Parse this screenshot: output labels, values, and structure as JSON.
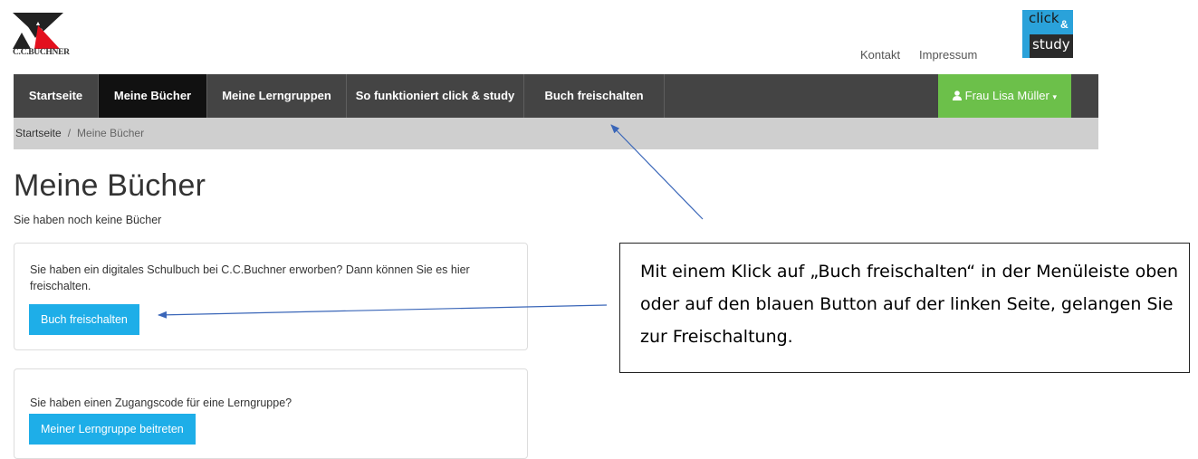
{
  "header": {
    "publisher_logo": {
      "text": "C.C.BUCHNER",
      "colors": {
        "red": "#e3101e",
        "dark": "#222222"
      }
    },
    "product_logo": {
      "click": "click",
      "amp": "&",
      "study": "study",
      "colors": {
        "blue": "#2aa2da",
        "dark": "#2b2b2b"
      }
    },
    "links": {
      "kontakt": "Kontakt",
      "impressum": "Impressum"
    }
  },
  "nav": {
    "items": [
      {
        "label": "Startseite"
      },
      {
        "label": "Meine Bücher",
        "active": true
      },
      {
        "label": "Meine Lerngruppen"
      },
      {
        "label": "So funktioniert click & study"
      },
      {
        "label": "Buch freischalten"
      }
    ],
    "user": {
      "icon": "user-icon",
      "label": "Frau Lisa Müller",
      "caret": "▾"
    },
    "colors": {
      "bar": "#444444",
      "active": "#111111",
      "user": "#6cc04a"
    }
  },
  "breadcrumb": {
    "home": "Startseite",
    "separator": "/",
    "current": "Meine Bücher"
  },
  "main": {
    "title": "Meine Bücher",
    "subtitle": "Sie haben noch keine Bücher",
    "panel_unlock": {
      "text": "Sie haben ein digitales Schulbuch bei C.C.Buchner erworben? Dann können Sie es hier freischalten.",
      "button": "Buch freischalten"
    },
    "panel_group": {
      "text": "Sie haben einen Zugangscode für eine Lerngruppe?",
      "button": "Meiner Lerngruppe beitreten"
    },
    "button_color": "#1eaee8"
  },
  "annotation": {
    "text": "Mit einem Klick auf „Buch freischalten“ in der Menüleiste oben oder auf den blauen Button auf der linken Seite, gelangen Sie zur Freischaltung.",
    "arrow_color": "#3a66b8"
  }
}
